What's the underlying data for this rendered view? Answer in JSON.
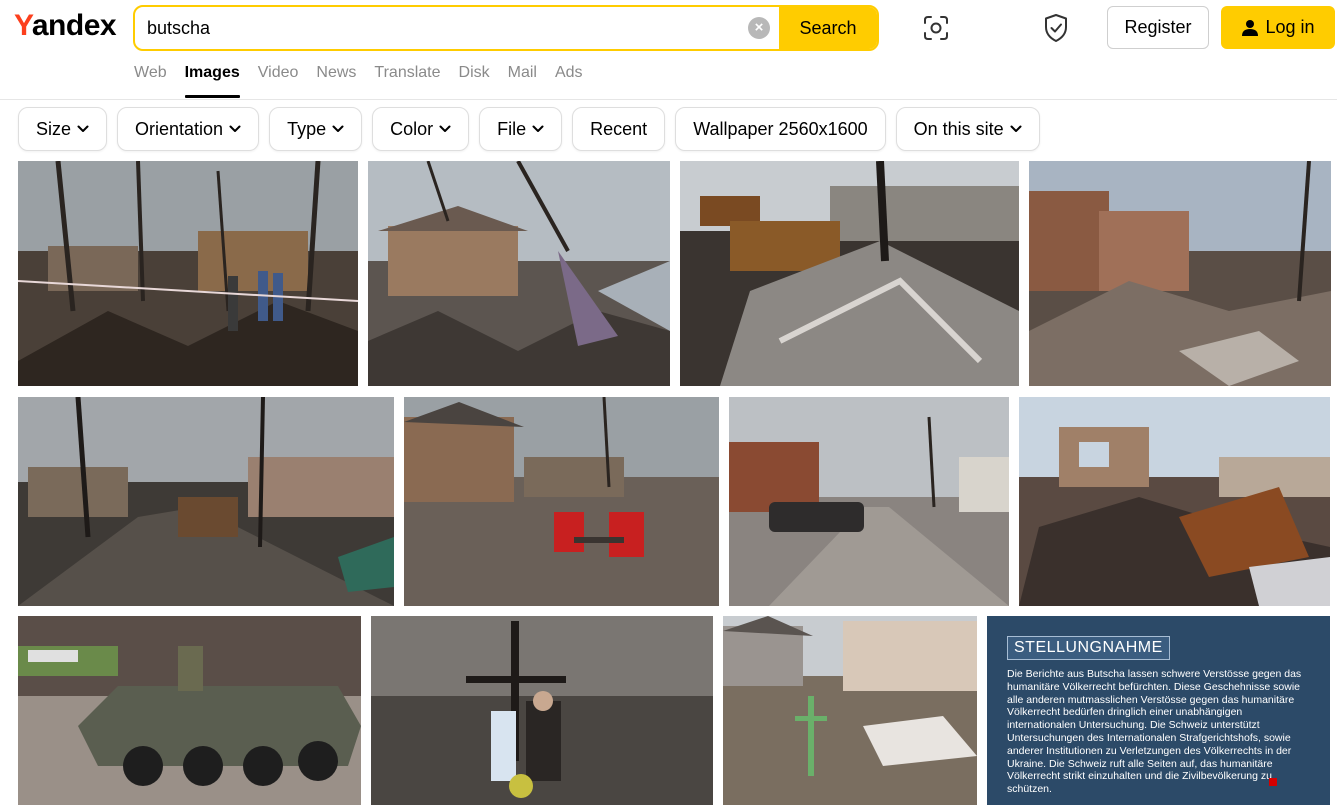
{
  "logo": {
    "first": "Y",
    "rest": "andex"
  },
  "search": {
    "value": "butscha",
    "button_label": "Search",
    "clear_symbol": "×"
  },
  "header": {
    "register_label": "Register",
    "login_label": "Log in"
  },
  "nav": {
    "items": [
      "Web",
      "Images",
      "Video",
      "News",
      "Translate",
      "Disk",
      "Mail",
      "Ads"
    ],
    "active": "Images"
  },
  "filters": {
    "items": [
      {
        "label": "Size",
        "dropdown": true
      },
      {
        "label": "Orientation",
        "dropdown": true
      },
      {
        "label": "Type",
        "dropdown": true
      },
      {
        "label": "Color",
        "dropdown": true
      },
      {
        "label": "File",
        "dropdown": true
      },
      {
        "label": "Recent",
        "dropdown": false
      },
      {
        "label": "Wallpaper 2560x1600",
        "dropdown": false
      },
      {
        "label": "On this site",
        "dropdown": true
      }
    ]
  },
  "statement": {
    "title": "STELLUNGNAHME",
    "body": "Die Berichte aus Butscha lassen schwere Verstösse gegen das humanitäre Völkerrecht befürchten. Diese Geschehnisse sowie alle anderen mutmasslichen Verstösse gegen das humanitäre Völkerrecht bedürfen dringlich einer unabhängigen internationalen Untersuchung. Die Schweiz unterstützt Untersuchungen des Internationalen Strafgerichtshofs, sowie anderer Institutionen zu Verletzungen des Völkerrechts in der Ukraine. Die Schweiz ruft alle Seiten auf, das humanitäre Völkerrecht strikt einzuhalten und die Zivilbevölkerung zu schützen."
  },
  "colors": {
    "accent": "#ffcc00",
    "logo_y": "#fc3f1d",
    "statement_bg": "#2c4a68"
  },
  "icons": {
    "lens": "camera-lens-icon",
    "shield": "shield-check-icon",
    "user": "user-icon",
    "chevron": "chevron-down-icon"
  }
}
